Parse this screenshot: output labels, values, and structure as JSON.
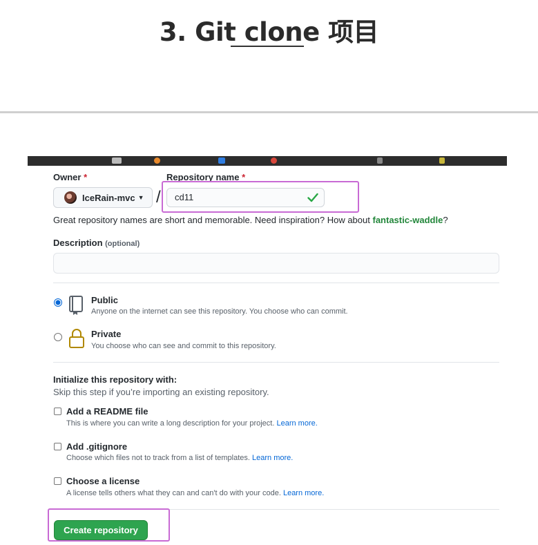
{
  "article": {
    "title": "3. Git clone 项目"
  },
  "form": {
    "owner_label": "Owner",
    "required_mark": "*",
    "owner_value": "IceRain-mvc",
    "slash": "/",
    "repo_label": "Repository name",
    "repo_value": "cd11",
    "hint_prefix": "Great repository names are short and memorable. Need inspiration? How about",
    "hint_suggestion": "fantastic-waddle",
    "hint_suffix": "?",
    "description_label": "Description",
    "description_optional": "(optional)",
    "description_value": "",
    "visibility": [
      {
        "title": "Public",
        "note": "Anyone on the internet can see this repository. You choose who can commit.",
        "selected": true
      },
      {
        "title": "Private",
        "note": "You choose who can see and commit to this repository.",
        "selected": false
      }
    ],
    "init_title": "Initialize this repository with:",
    "init_note": "Skip this step if you’re importing an existing repository.",
    "init_options": [
      {
        "title": "Add a README file",
        "note": "This is where you can write a long description for your project.",
        "link": "Learn more.",
        "checked": false
      },
      {
        "title": "Add .gitignore",
        "note": "Choose which files not to track from a list of templates.",
        "link": "Learn more.",
        "checked": false
      },
      {
        "title": "Choose a license",
        "note": "A license tells others what they can and can't do with your code.",
        "link": "Learn more.",
        "checked": false
      }
    ],
    "create_button": "Create repository"
  },
  "colors": {
    "create_button_bg": "#2ea44f",
    "suggestion": "#22863a",
    "link": "#0366d6",
    "highlight_box": "#c86ad4"
  }
}
